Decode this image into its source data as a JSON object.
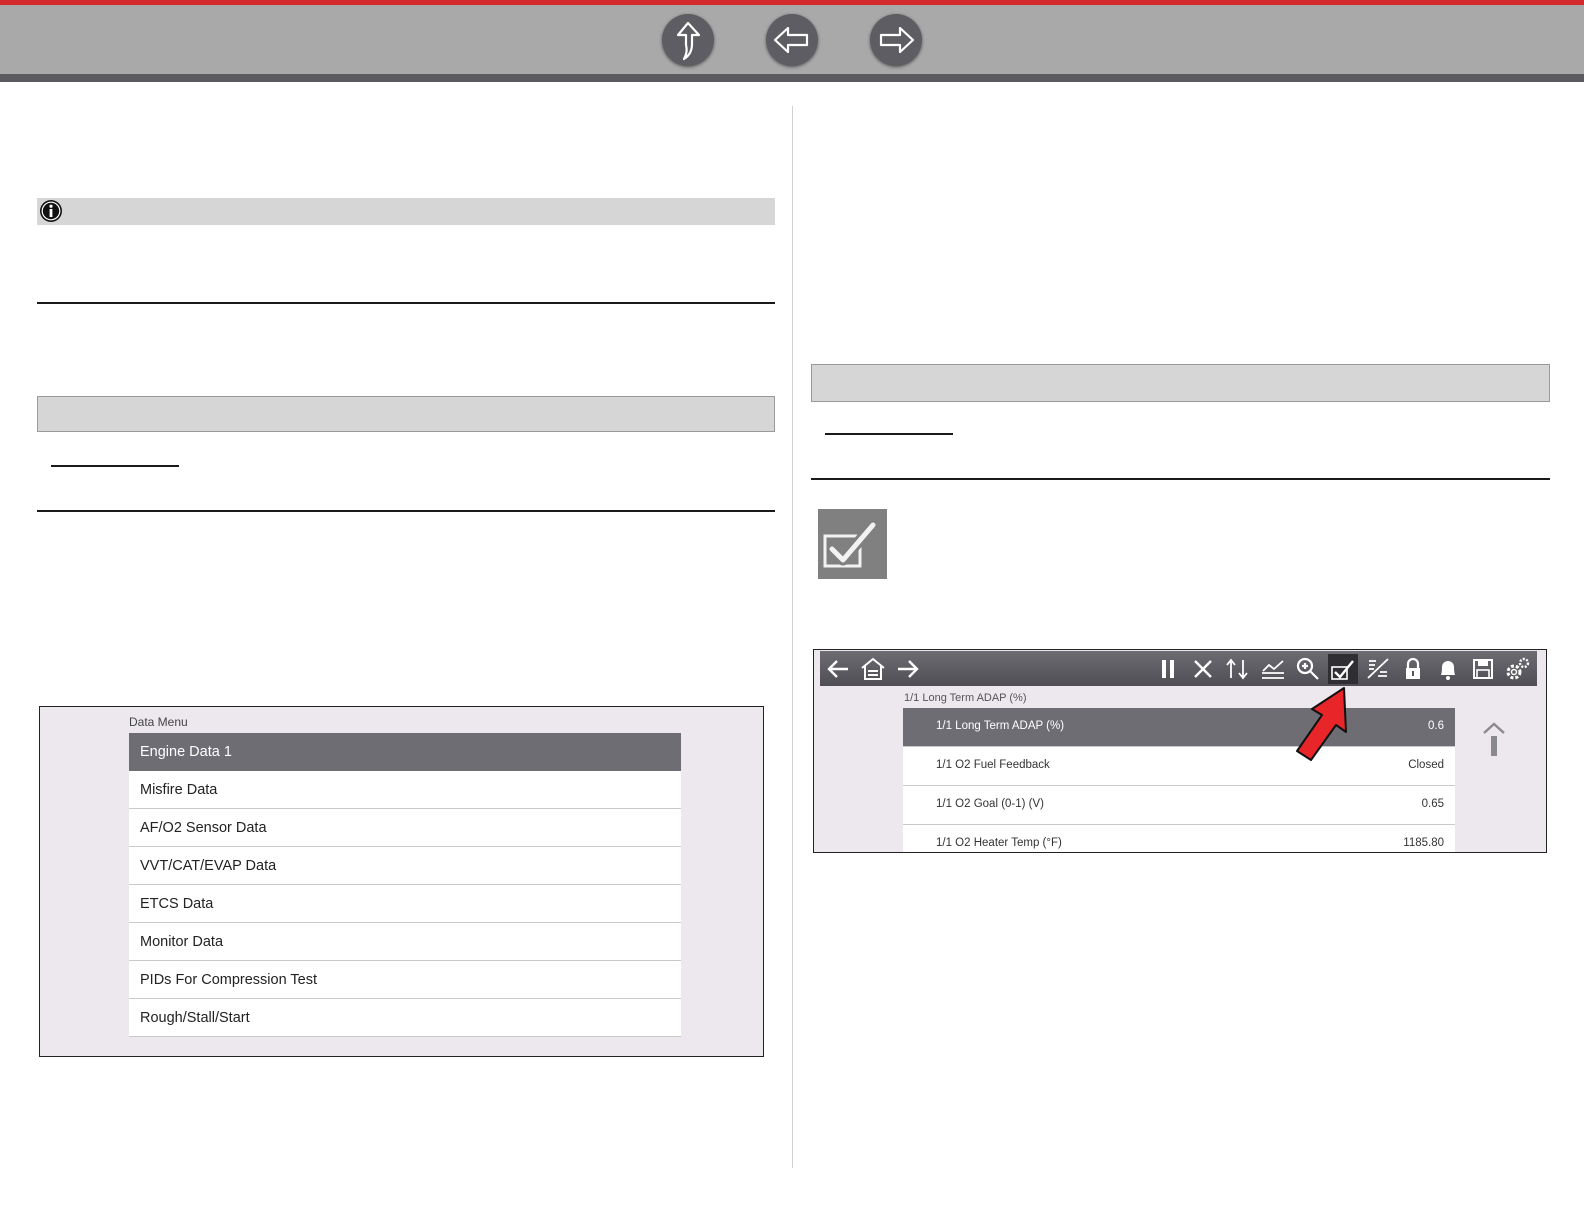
{
  "nav": {
    "icons": [
      "up-arrow-icon",
      "back-arrow-icon",
      "forward-arrow-icon"
    ]
  },
  "colors": {
    "accent": "#d42a2e",
    "nav_bg": "#a9a9a9",
    "selected_row": "#6e6d74",
    "pointer_arrow": "#e8262a"
  },
  "data_menu": {
    "title": "Data Menu",
    "items": [
      "Engine Data 1",
      "Misfire Data",
      "AF/O2 Sensor Data",
      "VVT/CAT/EVAP Data",
      "ETCS Data",
      "Monitor Data",
      "PIDs For Compression Test",
      "Rough/Stall/Start"
    ],
    "selected": "Engine Data 1"
  },
  "pid_screen": {
    "toolbar_icons": [
      "back-icon",
      "home-icon",
      "forward-icon",
      "pause-icon",
      "clear-icon",
      "sort-icon",
      "graph-icon",
      "zoom-icon",
      "select-check-icon",
      "custom-list-icon",
      "lock-icon",
      "alarm-icon",
      "save-icon",
      "settings-icon"
    ],
    "active_icon": "select-check-icon",
    "header": "1/1 Long Term ADAP (%)",
    "rows": [
      {
        "name": "1/1 Long Term ADAP (%)",
        "value": "0.6"
      },
      {
        "name": "1/1 O2 Fuel Feedback",
        "value": "Closed"
      },
      {
        "name": "1/1 O2 Goal (0-1) (V)",
        "value": "0.65"
      },
      {
        "name": "1/1 O2 Heater Temp (°F)",
        "value": "1185.80"
      }
    ]
  }
}
